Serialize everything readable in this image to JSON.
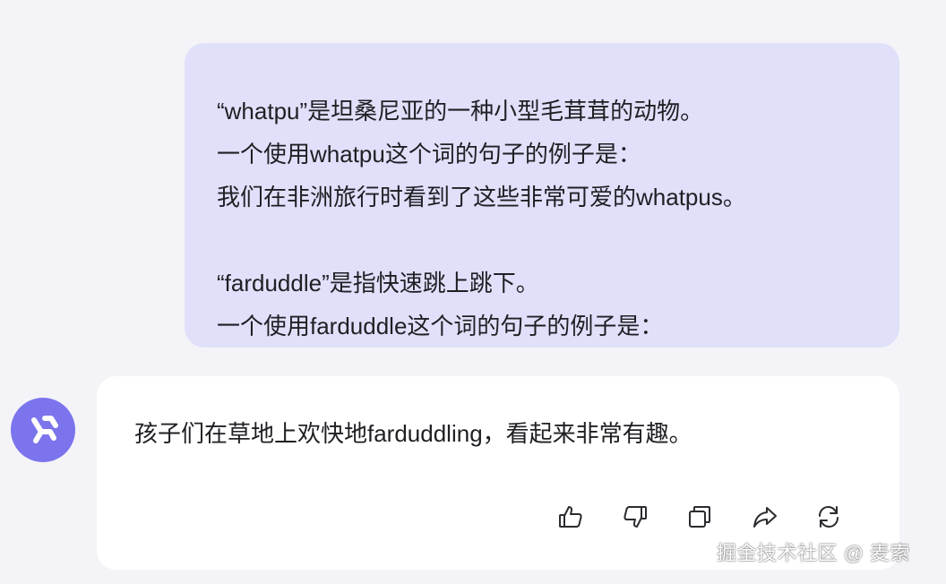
{
  "conversation": {
    "user_message": {
      "lines": [
        "“whatpu”是坦桑尼亚的一种小型毛茸茸的动物。",
        "一个使用whatpu这个词的句子的例子是：",
        "我们在非洲旅行时看到了这些非常可爱的whatpus。",
        "“farduddle”是指快速跳上跳下。",
        "一个使用farduddle这个词的句子的例子是："
      ]
    },
    "assistant_message": {
      "text": "孩子们在草地上欢快地farduddling，看起来非常有趣。",
      "actions": [
        {
          "name": "thumbs-up-icon"
        },
        {
          "name": "thumbs-down-icon"
        },
        {
          "name": "copy-icon"
        },
        {
          "name": "share-icon"
        },
        {
          "name": "regenerate-icon"
        }
      ]
    }
  },
  "watermark": "掘金技术社区 @ 麦索",
  "colors": {
    "background": "#f4f4f8",
    "user_bubble": "#e0e0fa",
    "assistant_card": "#ffffff",
    "avatar": "#7b74ec",
    "icon": "#2b2b30"
  }
}
